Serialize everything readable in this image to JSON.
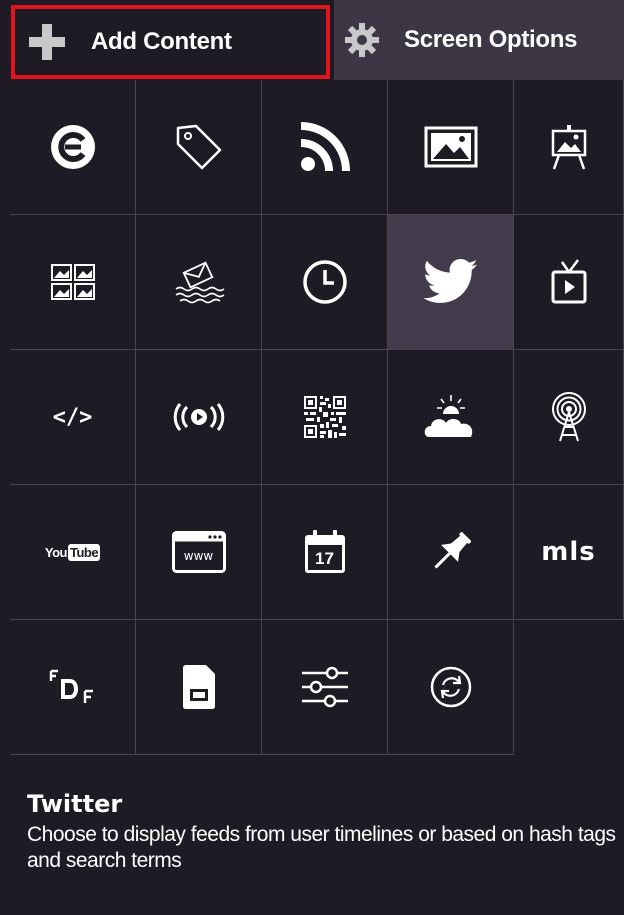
{
  "header": {
    "add_content_label": "Add Content",
    "screen_options_label": "Screen Options"
  },
  "colors": {
    "background": "#1f1b24",
    "selected_tab_outline": "#e0141b",
    "inactive_tab": "#3c3645",
    "selected_tile": "#413b4c"
  },
  "tiles": [
    {
      "icon": "c-logo-icon"
    },
    {
      "icon": "tag-icon"
    },
    {
      "icon": "rss-icon"
    },
    {
      "icon": "image-icon"
    },
    {
      "icon": "easel-slideshow-icon"
    },
    {
      "icon": "image-grid-icon"
    },
    {
      "icon": "message-bottle-icon"
    },
    {
      "icon": "clock-icon"
    },
    {
      "icon": "twitter-bird-icon",
      "selected": true
    },
    {
      "icon": "tv-play-icon"
    },
    {
      "icon": "code-embed-icon",
      "text": "</>"
    },
    {
      "icon": "broadcast-play-icon"
    },
    {
      "icon": "qr-code-icon"
    },
    {
      "icon": "weather-cloud-sun-icon"
    },
    {
      "icon": "radio-tower-icon"
    },
    {
      "icon": "youtube-icon",
      "text_left": "You",
      "text_right": "Tube"
    },
    {
      "icon": "web-page-icon",
      "text": "www"
    },
    {
      "icon": "calendar-icon",
      "text": "17"
    },
    {
      "icon": "pushpin-icon"
    },
    {
      "icon": "mls-icon",
      "text": "mls"
    },
    {
      "icon": "fdf-icon"
    },
    {
      "icon": "document-icon"
    },
    {
      "icon": "sliders-icon"
    },
    {
      "icon": "refresh-cycle-icon"
    }
  ],
  "description": {
    "title": "Twitter",
    "text": "Choose to display feeds from user timelines or based on hash tags and search terms"
  }
}
